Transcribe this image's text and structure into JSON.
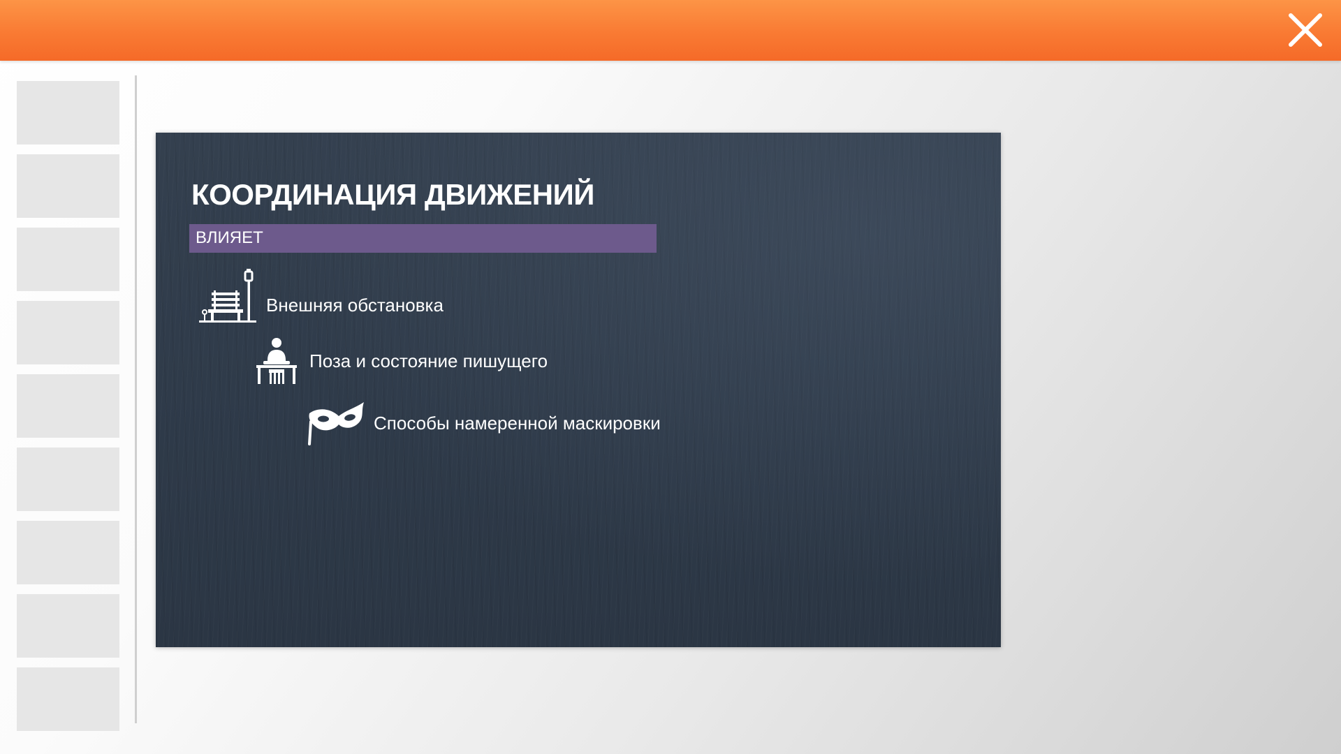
{
  "window": {
    "close_icon": "close-icon",
    "accent_color": "#f97a33"
  },
  "sidebar": {
    "thumbnail_count": 9
  },
  "slide": {
    "title": "КООРДИНАЦИЯ ДВИЖЕНИЙ",
    "subtitle": "ВЛИЯЕТ",
    "subtitle_bar_color": "#6d5a8c",
    "background_color": "#2f3b4a",
    "items": [
      {
        "label": "Внешняя обстановка",
        "icon": "park-bench-icon"
      },
      {
        "label": "Поза и состояние пишущего",
        "icon": "person-at-desk-icon"
      },
      {
        "label": "Способы намеренной маскировки",
        "icon": "masquerade-mask-icon"
      }
    ]
  }
}
